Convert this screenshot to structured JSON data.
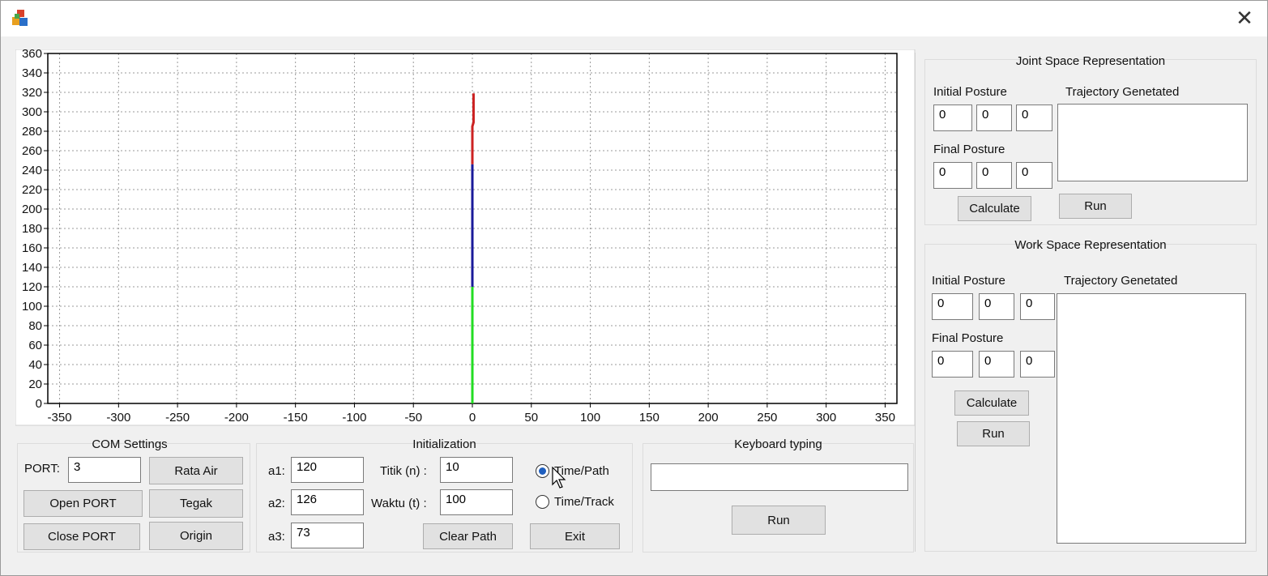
{
  "window": {
    "close_glyph": "✕",
    "icon": "app-icon"
  },
  "chart_data": {
    "type": "line",
    "title": "",
    "xlabel": "",
    "ylabel": "",
    "xlim": [
      -360,
      360
    ],
    "ylim": [
      0,
      360
    ],
    "x_ticks": [
      -350,
      -300,
      -250,
      -200,
      -150,
      -100,
      -50,
      0,
      50,
      100,
      150,
      200,
      250,
      300,
      350
    ],
    "y_ticks": [
      0,
      20,
      40,
      60,
      80,
      100,
      120,
      140,
      160,
      180,
      200,
      220,
      240,
      260,
      280,
      300,
      320,
      340,
      360
    ],
    "grid": true,
    "series": [
      {
        "color": "#22dd22",
        "points": [
          [
            0,
            0
          ],
          [
            0,
            60
          ],
          [
            0,
            120
          ]
        ]
      },
      {
        "color": "#1a1a9a",
        "points": [
          [
            0,
            120
          ],
          [
            0,
            246
          ]
        ]
      },
      {
        "color": "#cc2222",
        "points": [
          [
            0,
            246
          ],
          [
            0,
            285
          ],
          [
            1,
            289
          ],
          [
            1,
            319
          ]
        ]
      }
    ]
  },
  "com": {
    "title": "COM Settings",
    "port_label": "PORT:",
    "port_value": "3",
    "open_label": "Open PORT",
    "close_label": "Close PORT",
    "rata_air_label": "Rata Air",
    "tegak_label": "Tegak",
    "origin_label": "Origin"
  },
  "init": {
    "title": "Initialization",
    "a1_label": "a1:",
    "a1_value": "120",
    "a2_label": "a2:",
    "a2_value": "126",
    "a3_label": "a3:",
    "a3_value": "73",
    "titik_label": "Titik (n) :",
    "titik_value": "10",
    "waktu_label": "Waktu (t) :",
    "waktu_value": "100",
    "clear_label": "Clear Path",
    "exit_label": "Exit",
    "radio_path_label": "Time/Path",
    "radio_track_label": "Time/Track",
    "selected_radio": "Time/Path"
  },
  "keyboard": {
    "title": "Keyboard typing",
    "value": "",
    "run_label": "Run"
  },
  "joint": {
    "title": "Joint Space Representation",
    "initial_label": "Initial Posture",
    "final_label": "Final Posture",
    "traj_label": "Trajectory Genetated",
    "initial": [
      "0",
      "0",
      "0"
    ],
    "final": [
      "0",
      "0",
      "0"
    ],
    "calc_label": "Calculate",
    "run_label": "Run"
  },
  "work": {
    "title": "Work Space Representation",
    "initial_label": "Initial Posture",
    "final_label": "Final Posture",
    "traj_label": "Trajectory Genetated",
    "initial": [
      "0",
      "0",
      "0"
    ],
    "final": [
      "0",
      "0",
      "0"
    ],
    "calc_label": "Calculate",
    "run_label": "Run"
  }
}
